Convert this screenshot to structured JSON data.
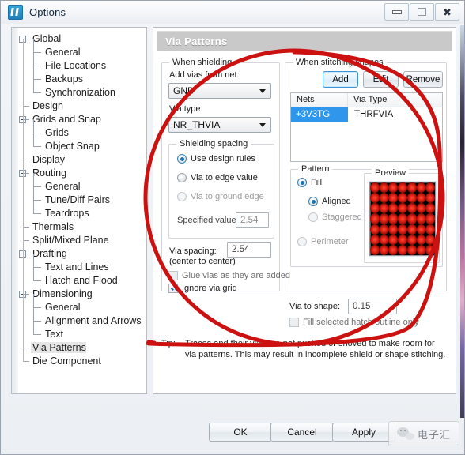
{
  "window": {
    "title": "Options",
    "icon": "app-icon",
    "minimize": "minimize",
    "maximize": "maximize",
    "close": "close"
  },
  "tree": {
    "items": [
      {
        "label": "Global",
        "level": 0,
        "expander": "minus",
        "selected": false
      },
      {
        "label": "General",
        "level": 1,
        "expander": "none",
        "selected": false
      },
      {
        "label": "File Locations",
        "level": 1,
        "expander": "none",
        "selected": false
      },
      {
        "label": "Backups",
        "level": 1,
        "expander": "none",
        "selected": false
      },
      {
        "label": "Synchronization",
        "level": 1,
        "expander": "none",
        "selected": false
      },
      {
        "label": "Design",
        "level": 0,
        "expander": "none",
        "selected": false
      },
      {
        "label": "Grids and Snap",
        "level": 0,
        "expander": "minus",
        "selected": false
      },
      {
        "label": "Grids",
        "level": 1,
        "expander": "none",
        "selected": false
      },
      {
        "label": "Object Snap",
        "level": 1,
        "expander": "none",
        "selected": false
      },
      {
        "label": "Display",
        "level": 0,
        "expander": "none",
        "selected": false
      },
      {
        "label": "Routing",
        "level": 0,
        "expander": "minus",
        "selected": false
      },
      {
        "label": "General",
        "level": 1,
        "expander": "none",
        "selected": false
      },
      {
        "label": "Tune/Diff Pairs",
        "level": 1,
        "expander": "none",
        "selected": false
      },
      {
        "label": "Teardrops",
        "level": 1,
        "expander": "none",
        "selected": false
      },
      {
        "label": "Thermals",
        "level": 0,
        "expander": "none",
        "selected": false
      },
      {
        "label": "Split/Mixed Plane",
        "level": 0,
        "expander": "none",
        "selected": false
      },
      {
        "label": "Drafting",
        "level": 0,
        "expander": "minus",
        "selected": false
      },
      {
        "label": "Text and Lines",
        "level": 1,
        "expander": "none",
        "selected": false
      },
      {
        "label": "Hatch and Flood",
        "level": 1,
        "expander": "none",
        "selected": false
      },
      {
        "label": "Dimensioning",
        "level": 0,
        "expander": "minus",
        "selected": false
      },
      {
        "label": "General",
        "level": 1,
        "expander": "none",
        "selected": false
      },
      {
        "label": "Alignment and Arrows",
        "level": 1,
        "expander": "none",
        "selected": false
      },
      {
        "label": "Text",
        "level": 1,
        "expander": "none",
        "selected": false
      },
      {
        "label": "Via Patterns",
        "level": 0,
        "expander": "none",
        "selected": true
      },
      {
        "label": "Die Component",
        "level": 0,
        "expander": "none",
        "selected": false
      }
    ]
  },
  "panel": {
    "header": "Via Patterns",
    "shielding": {
      "group_label": "When shielding",
      "net_label": "Add vias from net:",
      "net_value": "GND",
      "via_type_label": "Via type:",
      "via_type_value": "NR_THVIA",
      "spacing_group": "Shielding spacing",
      "options": [
        {
          "label": "Use design rules",
          "selected": true,
          "disabled": false
        },
        {
          "label": "Via to edge value",
          "selected": false,
          "disabled": false
        },
        {
          "label": "Via to ground edge",
          "selected": false,
          "disabled": true
        }
      ],
      "specified_label": "Specified value:",
      "specified_value": "2.54",
      "via_spacing_label": "Via spacing:",
      "via_spacing_sub": "(center to center)",
      "via_spacing_value": "2.54",
      "glue_label": "Glue vias as they are added",
      "glue_checked": false,
      "ignore_grid_label": "Ignore via grid",
      "ignore_grid_checked": true
    },
    "stitching": {
      "group_label": "When stitching shapes",
      "buttons": [
        {
          "label": "Add",
          "focused": true
        },
        {
          "label": "Edit",
          "focused": false
        },
        {
          "label": "Remove",
          "focused": false
        }
      ],
      "columns": [
        "Nets",
        "Via Type"
      ],
      "rows": [
        {
          "net": "+3V3TG",
          "via_type": "THRFVIA",
          "selected": true
        }
      ],
      "selection_color": "#2f97eb"
    },
    "pattern": {
      "group_label": "Pattern",
      "options": [
        {
          "label": "Fill",
          "selected": true,
          "disabled": false,
          "indent": 0
        },
        {
          "label": "Aligned",
          "selected": true,
          "disabled": false,
          "indent": 1
        },
        {
          "label": "Staggered",
          "selected": false,
          "disabled": true,
          "indent": 1
        },
        {
          "label": "Perimeter",
          "selected": false,
          "disabled": true,
          "indent": 0
        }
      ],
      "preview_label": "Preview",
      "preview": {
        "columns": 7,
        "rows": 7,
        "via_color": "#e32113",
        "background": "#000000"
      }
    },
    "via_to_shape_label": "Via to shape:",
    "via_to_shape_value": "0.15",
    "fill_hatch_label": "Fill selected hatch outline only",
    "fill_hatch_checked": false,
    "tip_word": "Tip:",
    "tip_text": "Traces and their vias are not pushed or shoved to make room for via patterns. This may result in incomplete shield or shape stitching."
  },
  "footer": {
    "ok": "OK",
    "cancel": "Cancel",
    "apply": "Apply",
    "watermark_text": "电子汇"
  },
  "annotation": {
    "color": "#cc1111",
    "shape": "red-ellipse-highlight"
  }
}
